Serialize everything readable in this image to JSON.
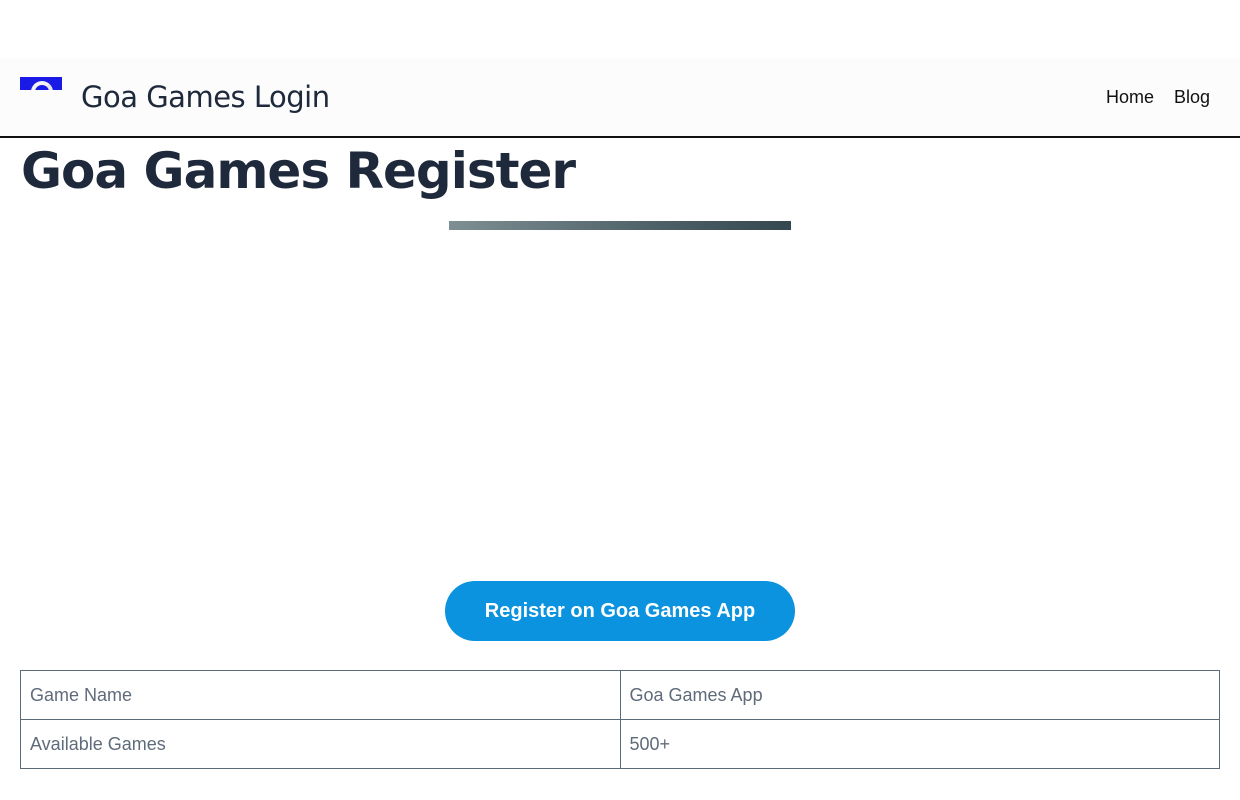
{
  "header": {
    "site_title": "Goa Games Login",
    "logo_icon": "goa-games-logo",
    "logo_color": "#1a1ae6",
    "nav": [
      {
        "label": "Home"
      },
      {
        "label": "Blog"
      }
    ]
  },
  "main": {
    "title": "Goa Games Register",
    "cta_label": "Register on Goa Games App",
    "cta_color": "#0b93e0"
  },
  "table": {
    "rows": [
      {
        "key": "Game Name",
        "value": "Goa Games App"
      },
      {
        "key": "Available Games",
        "value": "500+"
      }
    ]
  }
}
